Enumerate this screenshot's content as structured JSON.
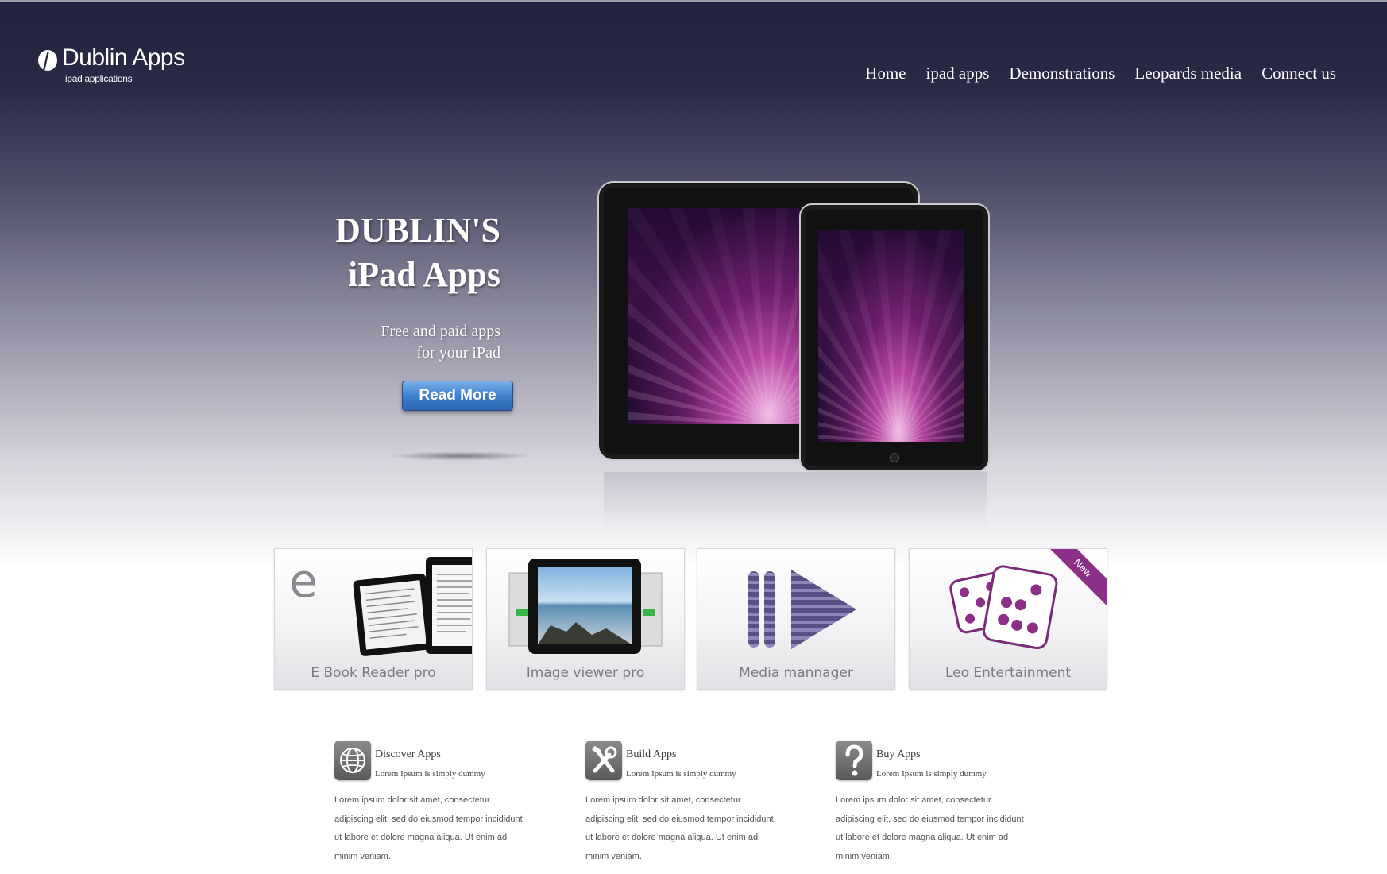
{
  "header": {
    "logo_title": "Dublin Apps",
    "logo_subtitle": "ipad applications",
    "nav": [
      "Home",
      "ipad apps",
      "Demonstrations",
      "Leopards media",
      "Connect us"
    ]
  },
  "hero": {
    "title_line1": "DUBLIN'S",
    "title_line2": "iPad Apps",
    "subtitle_line1": "Free and paid apps",
    "subtitle_line2": "for your iPad",
    "button_label": "Read More"
  },
  "apps": [
    {
      "label": "E Book Reader pro",
      "icon": "ebook-reader-icon"
    },
    {
      "label": "Image viewer pro",
      "icon": "image-viewer-icon"
    },
    {
      "label": "Media mannager",
      "icon": "media-play-icon"
    },
    {
      "label": "Leo Entertainment",
      "icon": "dice-icon",
      "badge": "New"
    }
  ],
  "features": [
    {
      "title": "Discover Apps",
      "tagline": "Lorem Ipsum is simply dummy",
      "icon": "globe-icon",
      "body": "Lorem ipsum dolor sit amet, consectetur adipiscing elit, sed do eiusmod tempor incididunt ut labore et dolore magna aliqua. Ut enim ad minim veniam."
    },
    {
      "title": "Build Apps",
      "tagline": "Lorem Ipsum is simply dummy",
      "icon": "tools-icon",
      "body": "Lorem ipsum dolor sit amet, consectetur adipiscing elit, sed do eiusmod tempor incididunt ut labore et dolore magna aliqua. Ut enim ad minim veniam."
    },
    {
      "title": "Buy Apps",
      "tagline": "Lorem Ipsum is simply dummy",
      "icon": "question-icon",
      "body": "Lorem ipsum dolor sit amet, consectetur adipiscing elit, sed do eiusmod tempor incididunt ut labore et dolore magna aliqua. Ut enim ad minim veniam."
    }
  ],
  "colors": {
    "header_dark": "#22213f",
    "button_blue": "#3f7fcc",
    "accent_purple": "#8c2f86"
  }
}
